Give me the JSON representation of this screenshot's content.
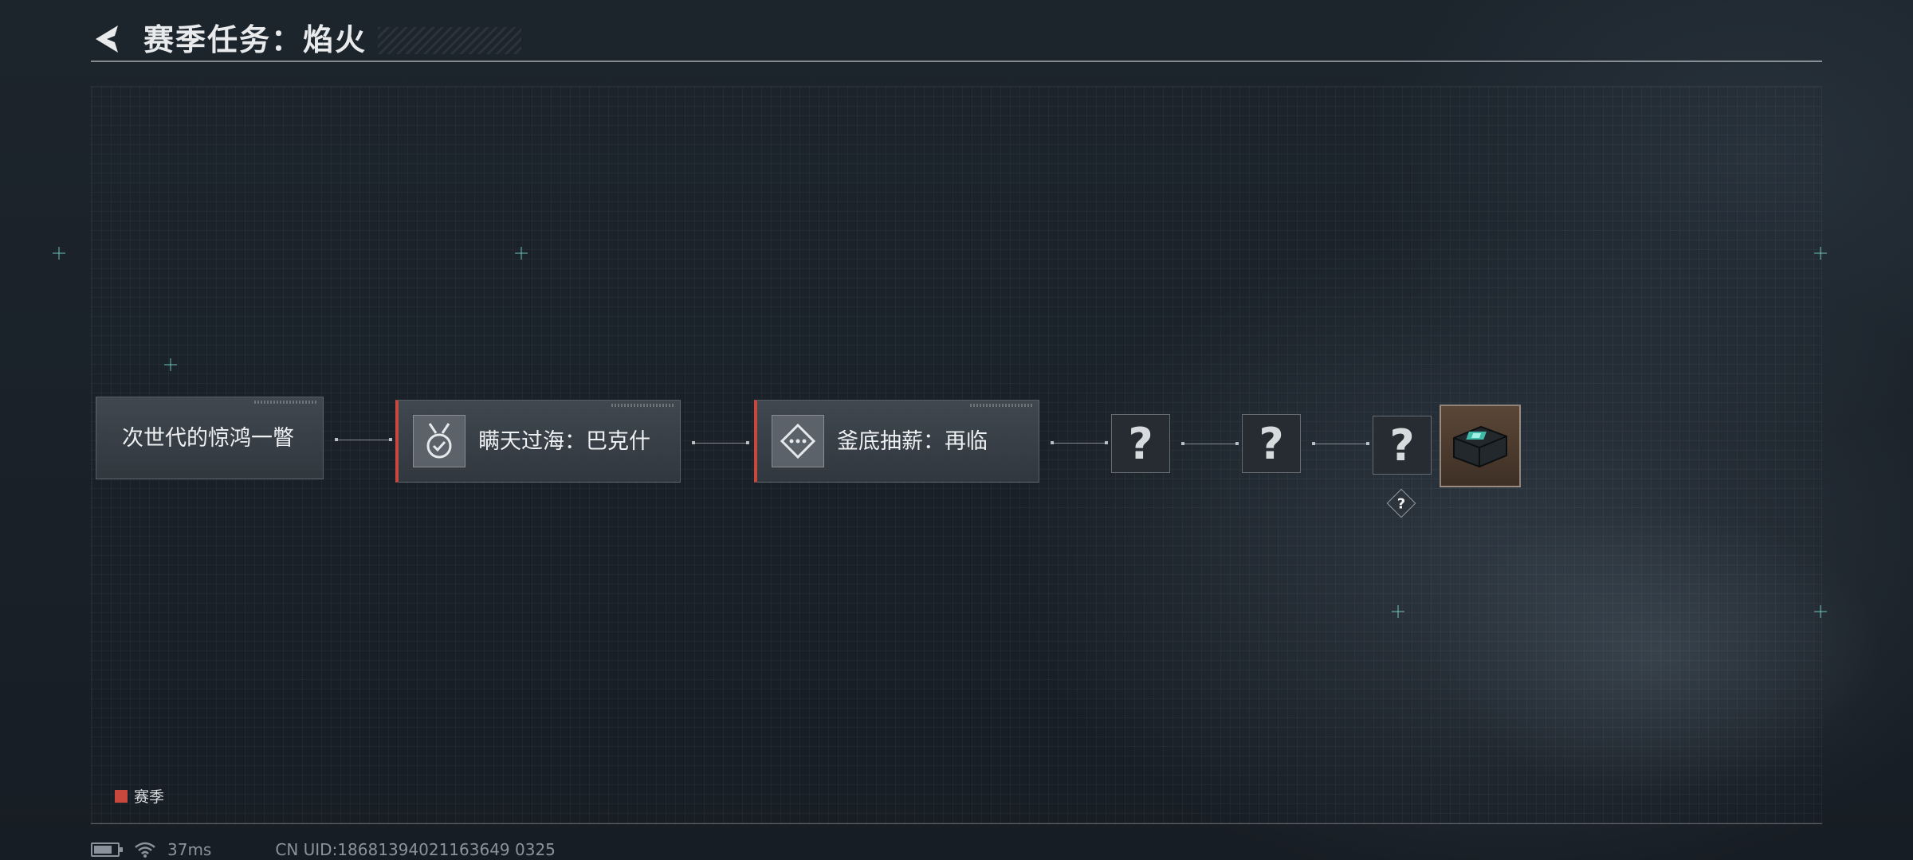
{
  "header": {
    "title": "赛季任务：焰火"
  },
  "task_chain": [
    {
      "label": "次世代的惊鸿一瞥",
      "active": false,
      "icon": "none"
    },
    {
      "label": "瞒天过海：巴克什",
      "active": true,
      "icon": "medal-check-icon"
    },
    {
      "label": "釜底抽薪：再临",
      "active": true,
      "icon": "target-diamond-icon"
    }
  ],
  "locked_nodes": [
    {
      "label": "?"
    },
    {
      "label": "?"
    },
    {
      "label": "?"
    }
  ],
  "reward": {
    "icon": "supply-crate-icon",
    "hint": "?"
  },
  "legend": {
    "label": "赛季",
    "color": "#c9483d"
  },
  "status": {
    "ping": "37ms",
    "uid": "CN UID:18681394021163649 0325"
  },
  "colors": {
    "accent_red": "#c9483d",
    "background": "#1a2129"
  }
}
